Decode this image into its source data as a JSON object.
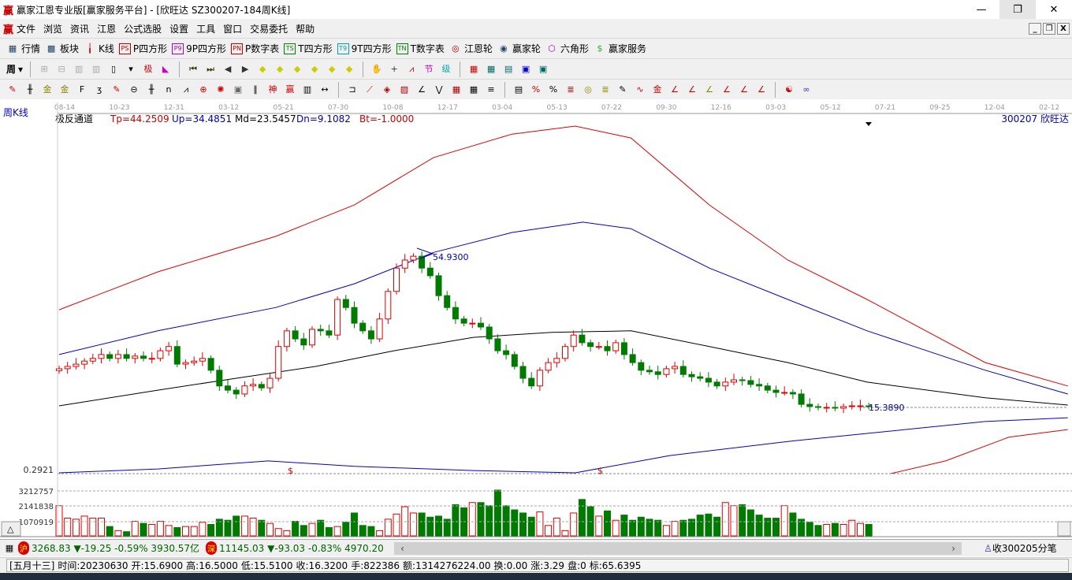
{
  "window": {
    "title": "赢家江恩专业版[赢家服务平台] - [欣旺达  SZ300207-184周K线]",
    "logo": "赢"
  },
  "menu": [
    "文件",
    "浏览",
    "资讯",
    "江恩",
    "公式选股",
    "设置",
    "工具",
    "窗口",
    "交易委托",
    "帮助"
  ],
  "toolbar1": [
    {
      "icon": "quote-table-icon",
      "label": "行情"
    },
    {
      "icon": "sector-icon",
      "label": "板块"
    },
    {
      "icon": "kline-icon",
      "label": "K线"
    },
    {
      "icon": "PS",
      "label": "P四方形",
      "color": "#c00000"
    },
    {
      "icon": "P9",
      "label": "9P四方形",
      "color": "#b000b0"
    },
    {
      "icon": "PN",
      "label": "P数字表",
      "color": "#c00000"
    },
    {
      "icon": "TS",
      "label": "T四方形",
      "color": "#008000"
    },
    {
      "icon": "T9",
      "label": "9T四方形",
      "color": "#00a0a0"
    },
    {
      "icon": "TN",
      "label": "T数字表",
      "color": "#008000"
    },
    {
      "icon": "gann-wheel-icon",
      "label": "江恩轮"
    },
    {
      "icon": "winner-wheel-icon",
      "label": "赢家轮"
    },
    {
      "icon": "hexagon-icon",
      "label": "六角形"
    },
    {
      "icon": "dollar-icon",
      "label": "赢家服务"
    }
  ],
  "toolbar2": {
    "period": "周"
  },
  "chart": {
    "period_label": "周K线",
    "indicator": {
      "name": "极反通道",
      "tp": "Tp=44.2509",
      "up": "Up=34.4851",
      "md": "Md=23.5457",
      "dn": "Dn=9.1082",
      "bt": "Bt=-1.0000"
    },
    "stock": "300207  欣旺达",
    "dates": [
      "08-14",
      "10-23",
      "12-31",
      "03-12",
      "05-21",
      "07-30",
      "10-08",
      "12-17",
      "03-04",
      "05-13",
      "07-22",
      "09-30",
      "12-16",
      "03-03",
      "05-12",
      "07-21",
      "09-25",
      "12-04",
      "02-12"
    ],
    "high_label": "54.9300",
    "low_label": "15.3890",
    "lower_axis_label": "0.2921",
    "volume_ticks": [
      "3212757",
      "2141838",
      "1070919"
    ],
    "colors": {
      "up": "#e00000",
      "down": "#007a00",
      "upper": "#e00000",
      "mid_band": "#0000cc",
      "center": "#000000"
    }
  },
  "chart_data": {
    "type": "candlestick",
    "closes": [
      25.5,
      26.1,
      26.7,
      27.5,
      28.2,
      29.2,
      28.2,
      29.2,
      28.2,
      28.8,
      28.2,
      28.2,
      30.2,
      31.3,
      26.7,
      27.1,
      27.5,
      28.2,
      25.1,
      21.0,
      19.9,
      18.9,
      21.0,
      21.4,
      20.5,
      23.0,
      31.3,
      35.4,
      33.3,
      31.7,
      35.8,
      35.4,
      34.3,
      43.6,
      41.5,
      37.4,
      35.4,
      33.3,
      38.5,
      45.7,
      51.8,
      53.9,
      54.9,
      51.8,
      49.8,
      44.6,
      41.5,
      38.5,
      37.4,
      37.4,
      36.4,
      33.3,
      30.2,
      29.2,
      26.1,
      23.0,
      21.0,
      25.1,
      27.1,
      28.2,
      31.3,
      34.3,
      32.3,
      31.3,
      31.3,
      30.2,
      32.3,
      29.2,
      27.1,
      25.1,
      24.7,
      24.0,
      25.5,
      26.1,
      24.0,
      23.4,
      23.0,
      22.0,
      21.0,
      22.0,
      22.6,
      22.4,
      21.4,
      21.0,
      19.9,
      19.3,
      19.3,
      18.9,
      16.2,
      15.6,
      15.4,
      15.4,
      15.2,
      15.6,
      15.8,
      15.8,
      15.6
    ],
    "volume_millions": [
      2.9,
      1.7,
      1.6,
      1.9,
      1.7,
      1.7,
      0.9,
      0.5,
      0.4,
      1.4,
      1.2,
      1.1,
      1.4,
      1.0,
      0.8,
      0.9,
      0.9,
      1.3,
      1.1,
      1.6,
      1.5,
      1.9,
      1.9,
      1.7,
      1.5,
      1.2,
      0.7,
      0.5,
      1.4,
      1.0,
      1.2,
      1.5,
      0.8,
      0.9,
      1.3,
      2.2,
      1.0,
      0.9,
      0.5,
      1.6,
      2.1,
      2.8,
      2.2,
      2.2,
      1.8,
      1.9,
      1.6,
      3.0,
      2.7,
      3.2,
      3.2,
      2.9,
      4.4,
      2.9,
      2.5,
      2.2,
      1.8,
      2.3,
      1.0,
      1.7,
      0.5,
      2.2,
      3.5,
      2.8,
      1.9,
      2.4,
      1.5,
      2.0,
      1.5,
      1.8,
      1.6,
      1.5,
      1.0,
      1.4,
      1.5,
      1.6,
      2.0,
      2.1,
      1.8,
      3.2,
      2.9,
      3.0,
      2.5,
      2.0,
      1.7,
      1.7,
      2.9,
      2.2,
      1.6,
      1.3,
      1.0,
      1.1,
      1.2,
      1.1,
      1.5,
      1.2,
      1.1,
      1.0,
      0.2
    ],
    "bands": {
      "upper": [
        [
          0,
          40.9
        ],
        [
          11.7,
          50.8
        ],
        [
          25.7,
          60.1
        ],
        [
          35,
          68.3
        ],
        [
          44.4,
          80.7
        ],
        [
          53.7,
          86.8
        ],
        [
          61.2,
          88.9
        ],
        [
          67.8,
          85.8
        ],
        [
          77.1,
          68.3
        ],
        [
          86.4,
          53.9
        ],
        [
          95.8,
          43.6
        ],
        [
          109.8,
          27.1
        ],
        [
          119.6,
          21.0
        ]
      ],
      "up": [
        [
          0,
          29.2
        ],
        [
          11.7,
          35.4
        ],
        [
          25.7,
          41.5
        ],
        [
          35,
          47.7
        ],
        [
          44.4,
          55.9
        ],
        [
          53.7,
          61.1
        ],
        [
          62.1,
          63.8
        ],
        [
          67.8,
          62.1
        ],
        [
          77.1,
          51.8
        ],
        [
          86.4,
          43.6
        ],
        [
          95.8,
          35.4
        ],
        [
          109.8,
          25.1
        ],
        [
          119.6,
          18.9
        ]
      ],
      "md": [
        [
          0,
          15.8
        ],
        [
          11.7,
          19.9
        ],
        [
          21,
          23.0
        ],
        [
          30.4,
          26.1
        ],
        [
          39.7,
          30.2
        ],
        [
          49.1,
          33.7
        ],
        [
          58.4,
          35.0
        ],
        [
          67.8,
          35.4
        ],
        [
          77.1,
          31.3
        ],
        [
          86.4,
          27.1
        ],
        [
          95.8,
          22.0
        ],
        [
          109.8,
          17.9
        ],
        [
          119.6,
          16.0
        ]
      ],
      "dn": [
        [
          0,
          -1.7
        ],
        [
          11.7,
          -0.7
        ],
        [
          24.8,
          1.4
        ],
        [
          35,
          0
        ],
        [
          49.1,
          -1.1
        ],
        [
          61.2,
          -1.7
        ],
        [
          72.4,
          2.8
        ],
        [
          86.4,
          6.5
        ],
        [
          95.8,
          8.6
        ],
        [
          109.8,
          11.7
        ],
        [
          119.6,
          12.7
        ]
      ],
      "lower": [
        [
          98.6,
          -2.3
        ],
        [
          105.1,
          1.4
        ],
        [
          112.6,
          7.6
        ],
        [
          119.6,
          9.6
        ]
      ]
    }
  },
  "status": {
    "sh_badge": "沪",
    "sh": "3268.83 ▼-19.25 -0.59% 3930.57亿",
    "sz_badge": "深",
    "sz": "11145.03 ▼-93.03 -0.83% 4970.20",
    "right": "收300205分笔"
  },
  "info": {
    "lunar": "[五月十三]",
    "time": "时间:20230630",
    "open": "开:15.6900",
    "high": "高:16.5000",
    "low": "低:15.5100",
    "close": "收:16.3200",
    "hand": "手:822386",
    "amount": "额:1314276224.00",
    "turnover": "换:0.00",
    "change": "涨:3.29",
    "pan": "盘:0",
    "mark": "标:65.6395"
  }
}
